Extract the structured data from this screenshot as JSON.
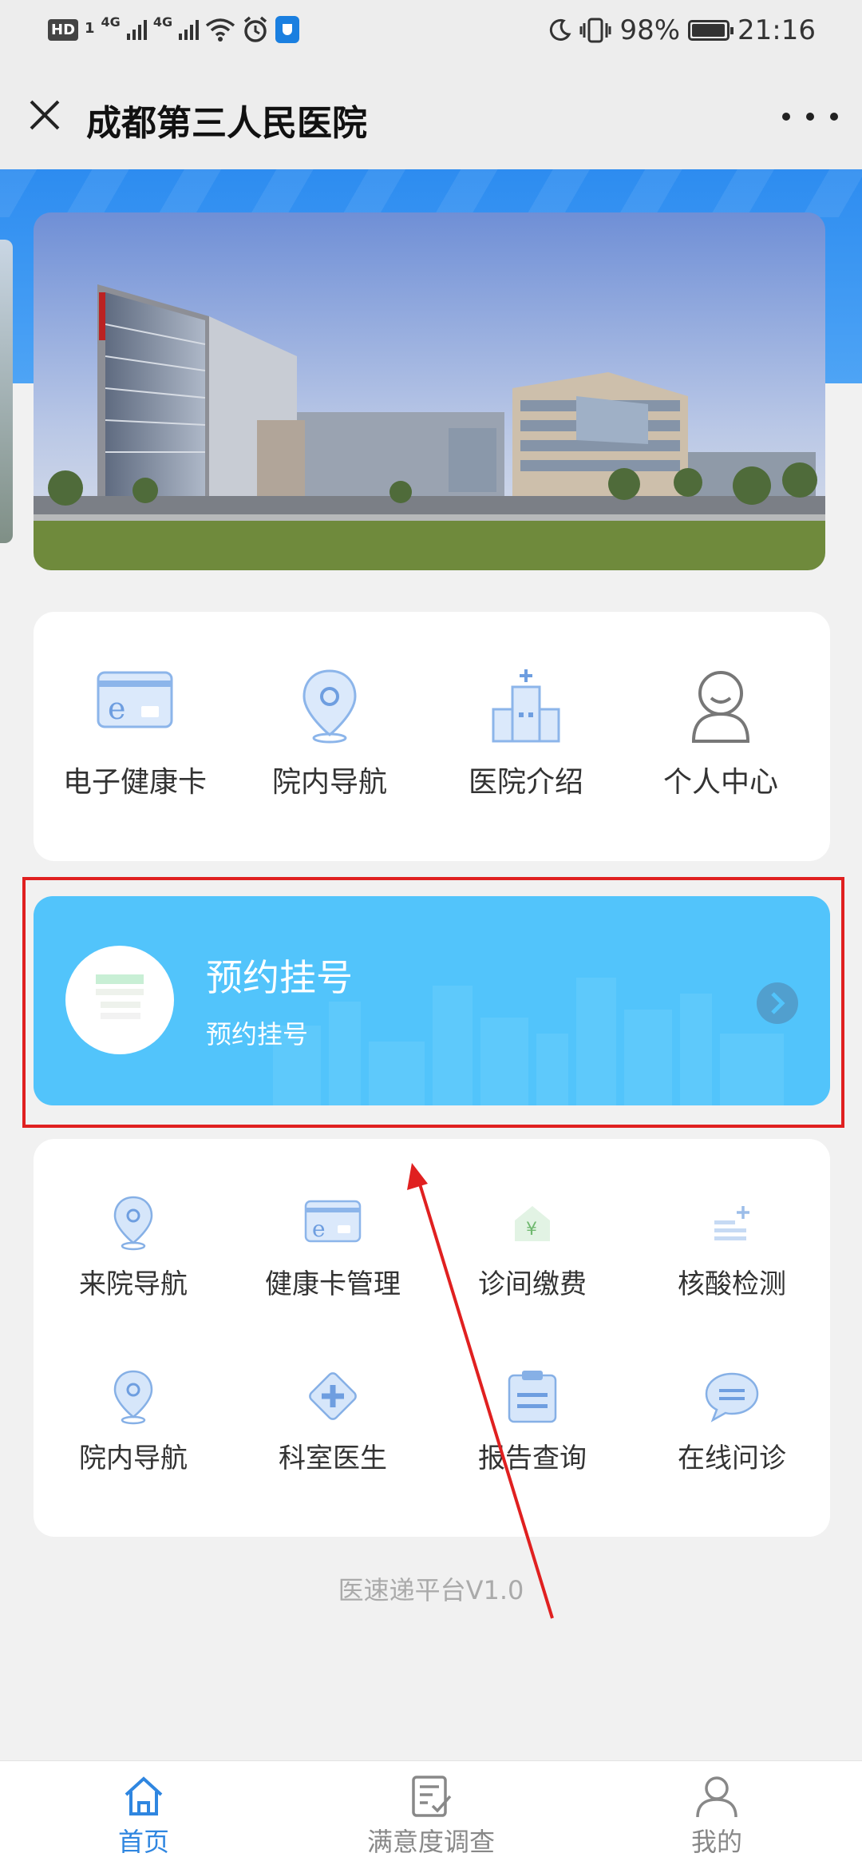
{
  "status_bar": {
    "hd": "HD",
    "sim1": "1",
    "signal1": "4G",
    "signal2": "4G",
    "battery_pct": "98%",
    "time": "21:16"
  },
  "title_bar": {
    "title": "成都第三人民医院"
  },
  "quick_menu": [
    {
      "label": "电子健康卡",
      "icon": "ehealth-card-icon"
    },
    {
      "label": "院内导航",
      "icon": "location-pin-icon"
    },
    {
      "label": "医院介绍",
      "icon": "hospital-building-icon"
    },
    {
      "label": "个人中心",
      "icon": "user-icon"
    }
  ],
  "appointment": {
    "title": "预约挂号",
    "subtitle": "预约挂号"
  },
  "services": [
    {
      "label": "来院导航",
      "icon": "location-pin-icon"
    },
    {
      "label": "健康卡管理",
      "icon": "health-card-icon"
    },
    {
      "label": "诊间缴费",
      "icon": "payment-icon"
    },
    {
      "label": "核酸检测",
      "icon": "list-plus-icon"
    },
    {
      "label": "院内导航",
      "icon": "location-pin-icon"
    },
    {
      "label": "科室医生",
      "icon": "medical-cross-icon"
    },
    {
      "label": "报告查询",
      "icon": "clipboard-icon"
    },
    {
      "label": "在线问诊",
      "icon": "chat-bubble-icon"
    }
  ],
  "footer": {
    "version": "医速递平台V1.0"
  },
  "tabs": [
    {
      "label": "首页",
      "active": true
    },
    {
      "label": "满意度调查",
      "active": false
    },
    {
      "label": "我的",
      "active": false
    }
  ],
  "colors": {
    "accent_blue": "#2f86e0",
    "appointment_bg": "#52c4fb",
    "highlight_red": "#e02020"
  }
}
